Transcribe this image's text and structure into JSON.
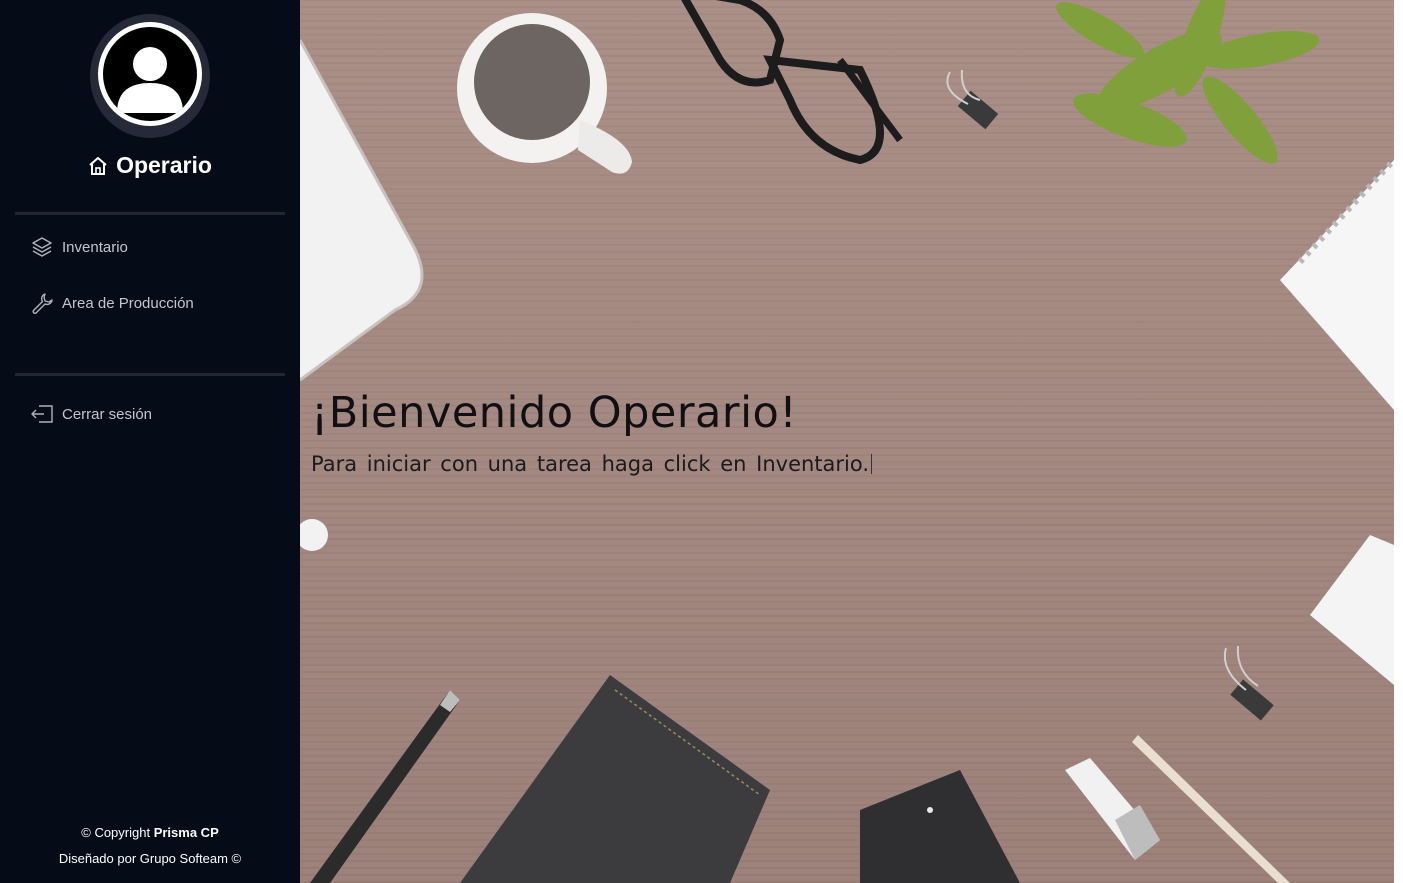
{
  "sidebar": {
    "role": "Operario",
    "nav": [
      {
        "label": "Inventario",
        "icon": "layers-icon"
      },
      {
        "label": "Area de Producción",
        "icon": "wrench-icon"
      }
    ],
    "logout": {
      "label": "Cerrar sesión",
      "icon": "logout-icon"
    },
    "footer": {
      "copyright_prefix": "© Copyright ",
      "brand": "Prisma CP",
      "designed_by": "Diseñado por Grupo Softeam ©"
    },
    "background_color": "#050b17"
  },
  "main": {
    "title": "¡Bienvenido Operario!",
    "subtitle": "Para iniciar con una tarea haga click en Inventario."
  }
}
